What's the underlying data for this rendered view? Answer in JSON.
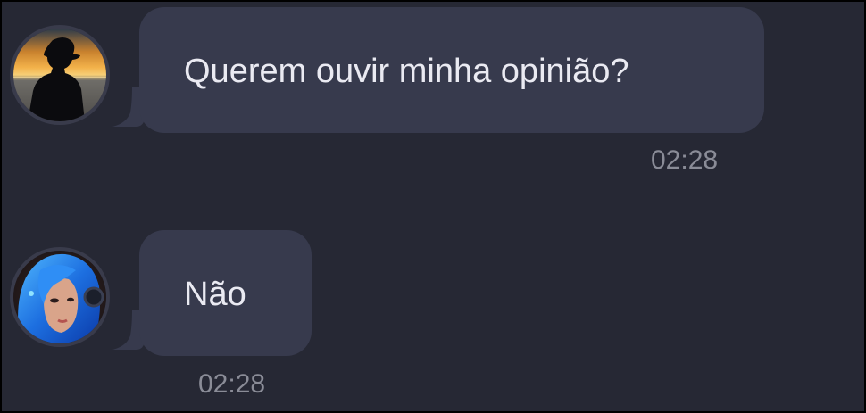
{
  "messages": [
    {
      "avatar_icon": "silhouette-sunset-avatar-icon",
      "text": "Querem ouvir minha opinião?",
      "time": "02:28"
    },
    {
      "avatar_icon": "blue-hair-girl-avatar-icon",
      "text": "Não",
      "time": "02:28"
    }
  ],
  "colors": {
    "background": "#262834",
    "bubble": "#373a4d",
    "bubble_text": "#eaeaf2",
    "timestamp": "#8a8c97",
    "avatar_ring": "#393b4b"
  }
}
